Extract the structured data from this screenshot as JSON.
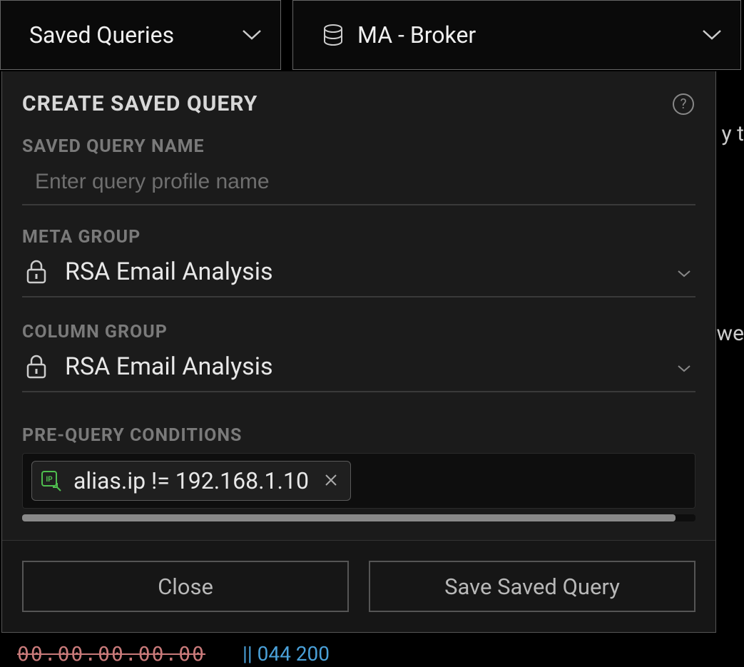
{
  "top": {
    "saved_queries_label": "Saved Queries",
    "broker_label": "MA - Broker"
  },
  "panel": {
    "title": "CREATE SAVED QUERY",
    "fields": {
      "name_label": "SAVED QUERY NAME",
      "name_placeholder": "Enter query profile name",
      "meta_group_label": "META GROUP",
      "meta_group_value": "RSA Email Analysis",
      "column_group_label": "COLUMN GROUP",
      "column_group_value": "RSA Email Analysis",
      "conditions_label": "PRE-QUERY CONDITIONS",
      "condition_chip": "alias.ip != 192.168.1.10"
    },
    "buttons": {
      "close": "Close",
      "save": "Save Saved Query"
    }
  },
  "background": {
    "right_text_1": "y t",
    "right_text_2": "we",
    "bottom_left": "00.00.00.00.00",
    "bottom_link": "|| 044 200"
  }
}
